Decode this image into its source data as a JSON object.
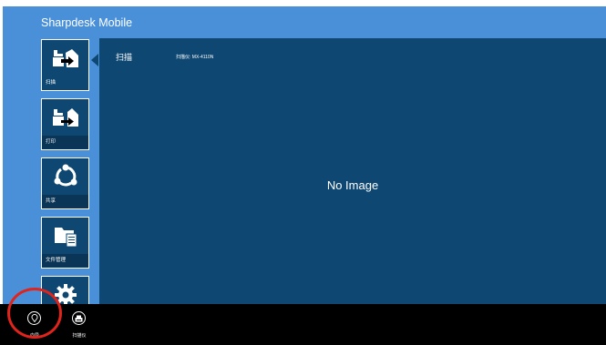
{
  "app": {
    "title": "Sharpdesk Mobile"
  },
  "nav": [
    {
      "label": "扫描",
      "icon": "scan-icon"
    },
    {
      "label": "打印",
      "icon": "print-icon"
    },
    {
      "label": "共享",
      "icon": "share-icon"
    },
    {
      "label": "文件管理",
      "icon": "file-management-icon"
    },
    {
      "label": "",
      "icon": "settings-gear-icon"
    }
  ],
  "main": {
    "title": "扫描",
    "device": "扫描仪: MX-4110N",
    "placeholder": "No Image"
  },
  "appbar": {
    "buttons": [
      {
        "label": "向导",
        "icon": "guide-pin-icon"
      },
      {
        "label": "扫描仪",
        "icon": "scanner-icon"
      }
    ]
  },
  "colors": {
    "app_bg": "#4A90D9",
    "panel": "#0E4872",
    "label_bar": "#0A3556",
    "appbar": "#000000",
    "highlight": "#E0231B"
  }
}
